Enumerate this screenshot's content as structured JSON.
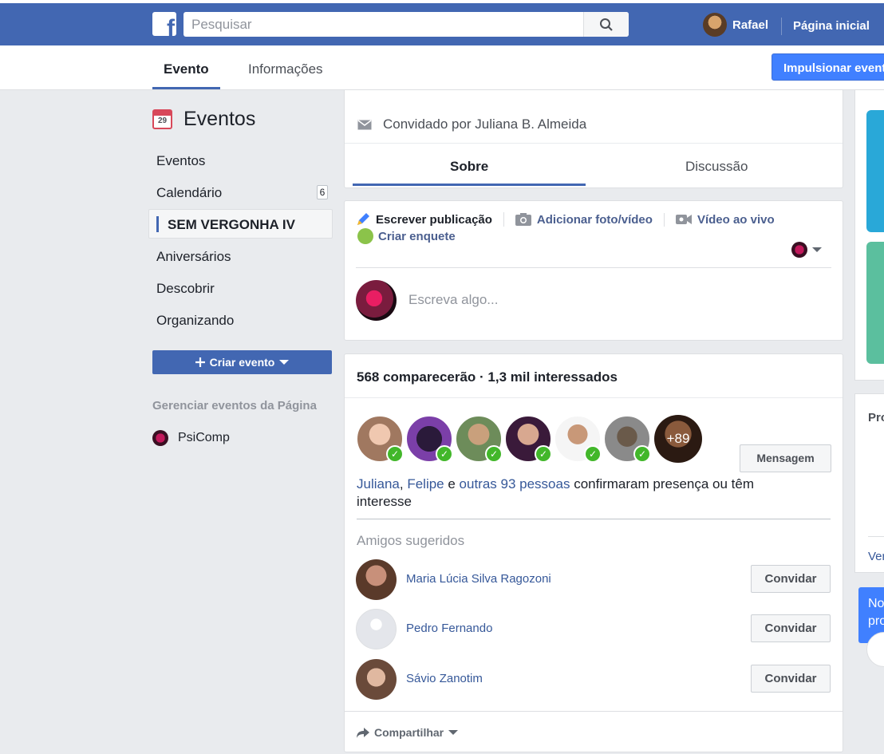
{
  "topbar": {
    "logo": "f",
    "search_placeholder": "Pesquisar",
    "user_name": "Rafael",
    "home_label": "Página inicial"
  },
  "tabs": {
    "event": "Evento",
    "info": "Informações",
    "boost": "Impulsionar evento"
  },
  "sidebar": {
    "title": "Eventos",
    "calendar_day": "29",
    "items": [
      {
        "label": "Eventos"
      },
      {
        "label": "Calendário",
        "badge": "6"
      },
      {
        "label": "SEM VERGONHA IV"
      },
      {
        "label": "Aniversários"
      },
      {
        "label": "Descobrir"
      },
      {
        "label": "Organizando"
      }
    ],
    "create_label": "Criar evento",
    "manage_title": "Gerenciar eventos da Página",
    "page_name": "PsiComp"
  },
  "invite": {
    "text": "Convidado por Juliana B. Almeida",
    "tab_about": "Sobre",
    "tab_discussion": "Discussão"
  },
  "composer": {
    "write": "Escrever publicação",
    "photo": "Adicionar foto/vídeo",
    "live": "Vídeo ao vivo",
    "poll": "Criar enquete",
    "placeholder": "Escreva algo..."
  },
  "guests": {
    "summary": "568 comparecerão · 1,3 mil interessados",
    "more_count": "+89",
    "message_button": "Mensagem",
    "name1": "Juliana",
    "comma": ", ",
    "name2": "Felipe",
    "and": " e ",
    "others": "outras 93 pessoas",
    "rest": " confirmaram presença ou têm interesse",
    "suggested_title": "Amigos sugeridos",
    "friends": [
      {
        "name": "Maria Lúcia Silva Ragozoni",
        "button": "Convidar"
      },
      {
        "name": "Pedro Fernando",
        "button": "Convidar"
      },
      {
        "name": "Sávio Zanotim",
        "button": "Convidar"
      }
    ],
    "share": "Compartilhar"
  },
  "right": {
    "card_title": "Pro",
    "card_link": "Ver",
    "tip_text": "No pro"
  },
  "colors": {
    "brand_blue": "#4267b2",
    "boost_blue": "#4080ff",
    "link": "#365899",
    "going_green": "#42b72a"
  }
}
